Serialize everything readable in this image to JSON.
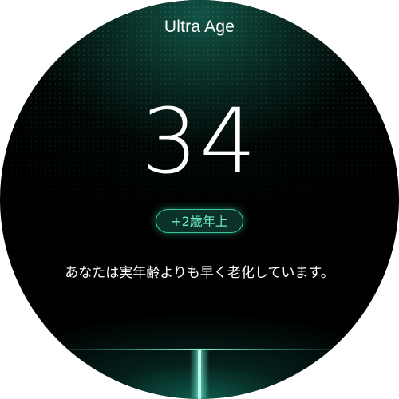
{
  "app": {
    "title": "Ultra Age"
  },
  "age": {
    "value": "34",
    "difference_badge": "+2歳年上",
    "message": "あなたは実年齢よりも早く老化しています。"
  },
  "colors": {
    "background": "#000000",
    "accent": "#35c9a2",
    "badge_text": "#6fe8c6",
    "text": "#ffffff"
  }
}
